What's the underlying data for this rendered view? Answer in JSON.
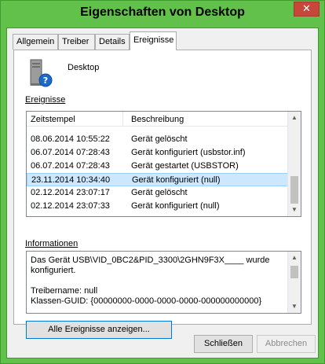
{
  "window": {
    "title": "Eigenschaften von Desktop",
    "close_glyph": "✕"
  },
  "tabs": [
    {
      "label": "Allgemein",
      "active": false
    },
    {
      "label": "Treiber",
      "active": false
    },
    {
      "label": "Details",
      "active": false
    },
    {
      "label": "Ereignisse",
      "active": true
    }
  ],
  "device": {
    "name": "Desktop",
    "icon": "computer-question-icon"
  },
  "events": {
    "label": "Ereignisse",
    "columns": [
      "Zeitstempel",
      "Beschreibung"
    ],
    "rows": [
      {
        "time": "08.06.2014 10:55:22",
        "desc": "Gerät gelöscht"
      },
      {
        "time": "06.07.2014 07:28:43",
        "desc": "Gerät konfiguriert (usbstor.inf)"
      },
      {
        "time": "06.07.2014 07:28:43",
        "desc": "Gerät gestartet (USBSTOR)"
      },
      {
        "time": "23.11.2014 10:34:40",
        "desc": "Gerät konfiguriert (null)",
        "selected": true
      },
      {
        "time": "02.12.2014 23:07:17",
        "desc": "Gerät gelöscht"
      },
      {
        "time": "02.12.2014 23:07:33",
        "desc": "Gerät konfiguriert (null)"
      }
    ]
  },
  "info": {
    "label": "Informationen",
    "text": "Das Gerät USB\\VID_0BC2&PID_3300\\2GHN9F3X____ wurde konfiguriert.\n\nTreibername: null\nKlassen-GUID: {00000000-0000-0000-0000-000000000000}"
  },
  "buttons": {
    "show_all": "Alle Ereignisse anzeigen...",
    "close": "Schließen",
    "cancel": "Abbrechen"
  },
  "colors": {
    "titlebar": "#61c14a",
    "close": "#c7483a",
    "selection": "#cce8ff"
  }
}
